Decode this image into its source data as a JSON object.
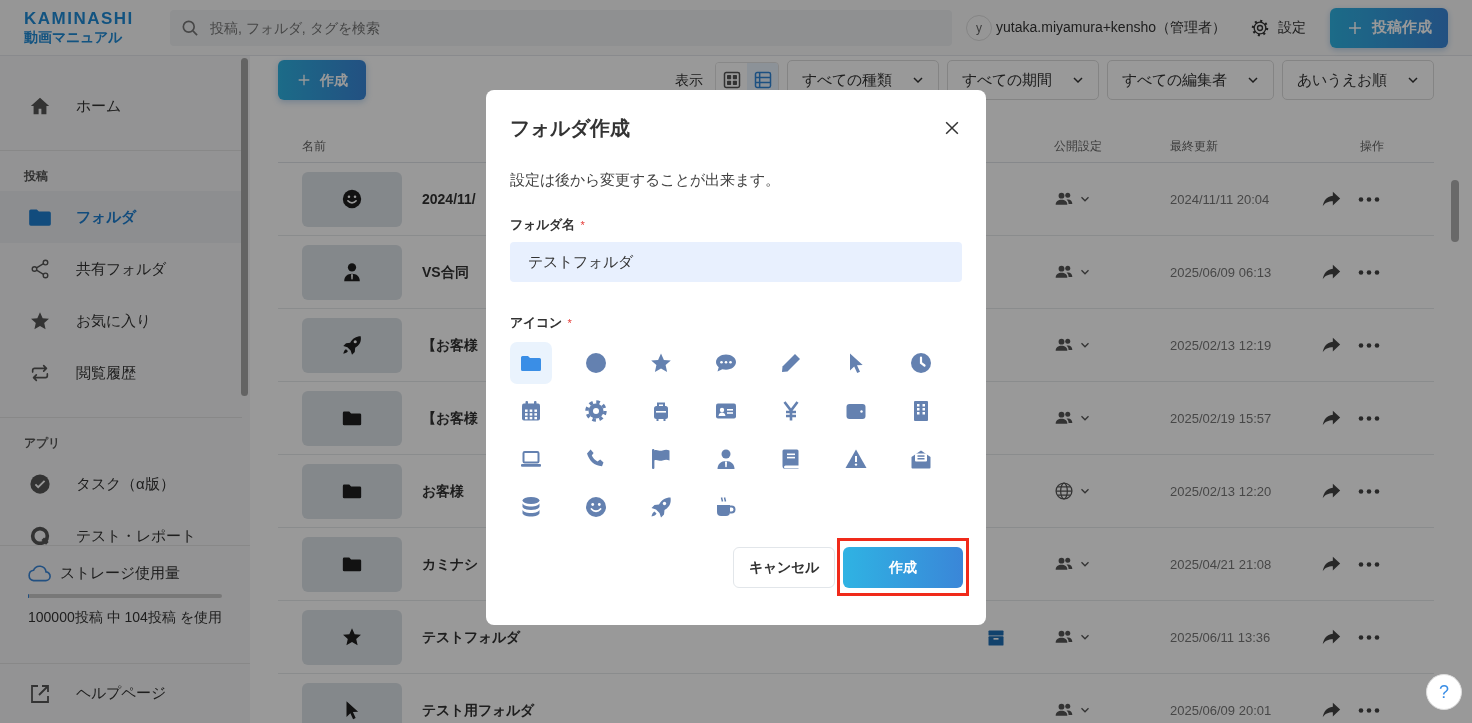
{
  "header": {
    "logo_top": "KAMINASHI",
    "logo_bottom": "動画マニュアル",
    "search": {
      "placeholder": "投稿, フォルダ, タグを検索"
    },
    "user": {
      "avatar": "y",
      "name": "yutaka.miyamura+kensho（管理者）"
    },
    "settings": "設定",
    "new_post_button": "投稿作成"
  },
  "sidebar": {
    "items": [
      {
        "kind": "home",
        "label": "ホーム",
        "selected": false
      },
      {
        "kind": "heading",
        "label": "投稿"
      },
      {
        "kind": "folder",
        "label": "フォルダ",
        "selected": true
      },
      {
        "kind": "share-nodes",
        "label": "共有フォルダ",
        "selected": false
      },
      {
        "kind": "star",
        "label": "お気に入り",
        "selected": false
      },
      {
        "kind": "repeat",
        "label": "閲覧履歴",
        "selected": false
      },
      {
        "kind": "heading",
        "label": "アプリ"
      },
      {
        "kind": "check-circle",
        "label": "タスク（α版）",
        "selected": false
      },
      {
        "kind": "q-ring",
        "label": "テスト・レポート",
        "selected": false
      }
    ],
    "storage": {
      "label": "ストレージ使用量",
      "level": 0.001,
      "usage": "100000投稿 中 104投稿 を使用"
    },
    "help": "ヘルプページ"
  },
  "toolbar": {
    "create_button": "作成",
    "view_label": "表示",
    "views": [
      {
        "kind": "grid",
        "selected": false
      },
      {
        "kind": "list",
        "selected": true
      }
    ],
    "filters": [
      "すべての種類",
      "すべての期間",
      "すべての編集者",
      "あいうえお順"
    ]
  },
  "table": {
    "columns": [
      "名前",
      "公開設定",
      "最終更新",
      "操作"
    ],
    "rows": [
      {
        "thumbnail": {
          "kind": "smile"
        },
        "name": "2024/11/",
        "tray": false,
        "visibility": {
          "kind": "group"
        },
        "updated": "2024/11/11 20:04"
      },
      {
        "thumbnail": {
          "kind": "person"
        },
        "name": "VS合同",
        "tray": false,
        "visibility": {
          "kind": "group"
        },
        "updated": "2025/06/09 06:13"
      },
      {
        "thumbnail": {
          "kind": "rocket"
        },
        "name": "【お客様",
        "tray": false,
        "visibility": {
          "kind": "group"
        },
        "updated": "2025/02/13 12:19"
      },
      {
        "thumbnail": {
          "kind": "folder"
        },
        "name": "【お客様",
        "tray": false,
        "visibility": {
          "kind": "group"
        },
        "updated": "2025/02/19 15:57"
      },
      {
        "thumbnail": {
          "kind": "folder"
        },
        "name": "お客様",
        "tray": false,
        "visibility": {
          "kind": "globe"
        },
        "updated": "2025/02/13 12:20"
      },
      {
        "thumbnail": {
          "kind": "folder"
        },
        "name": "カミナシ",
        "tray": false,
        "visibility": {
          "kind": "group"
        },
        "updated": "2025/04/21 21:08"
      },
      {
        "thumbnail": {
          "kind": "star"
        },
        "name": "テストフォルダ",
        "tray": true,
        "visibility": {
          "kind": "group"
        },
        "updated": "2025/06/11 13:36"
      },
      {
        "thumbnail": {
          "kind": "cursor"
        },
        "name": "テスト用フォルダ",
        "tray": false,
        "visibility": {
          "kind": "group"
        },
        "updated": "2025/06/09 20:01"
      }
    ]
  },
  "dialog": {
    "title": "フォルダ作成",
    "description": "設定は後から変更することが出来ます。",
    "name_field": {
      "label": "フォルダ名",
      "required_mark": "*",
      "value": "テストフォルダ"
    },
    "icon_field": {
      "label": "アイコン",
      "required_mark": "*",
      "icons": [
        {
          "kind": "folder",
          "selected": true
        },
        {
          "kind": "circle",
          "selected": false
        },
        {
          "kind": "star",
          "selected": false
        },
        {
          "kind": "chat",
          "selected": false
        },
        {
          "kind": "pencil",
          "selected": false
        },
        {
          "kind": "cursor",
          "selected": false
        },
        {
          "kind": "clock",
          "selected": false
        },
        {
          "kind": "calendar",
          "selected": false
        },
        {
          "kind": "gear",
          "selected": false
        },
        {
          "kind": "suitcase",
          "selected": false
        },
        {
          "kind": "idcard",
          "selected": false
        },
        {
          "kind": "yen",
          "selected": false
        },
        {
          "kind": "wallet",
          "selected": false
        },
        {
          "kind": "building",
          "selected": false
        },
        {
          "kind": "laptop",
          "selected": false
        },
        {
          "kind": "phone",
          "selected": false
        },
        {
          "kind": "flag",
          "selected": false
        },
        {
          "kind": "person",
          "selected": false
        },
        {
          "kind": "book",
          "selected": false
        },
        {
          "kind": "warning",
          "selected": false
        },
        {
          "kind": "mail",
          "selected": false
        },
        {
          "kind": "database",
          "selected": false
        },
        {
          "kind": "smile",
          "selected": false
        },
        {
          "kind": "rocket",
          "selected": false
        },
        {
          "kind": "coffee",
          "selected": false
        }
      ]
    },
    "cancel_button": "キャンセル",
    "create_button": {
      "label": "作成",
      "highlighted": true
    }
  },
  "help_button": "?"
}
